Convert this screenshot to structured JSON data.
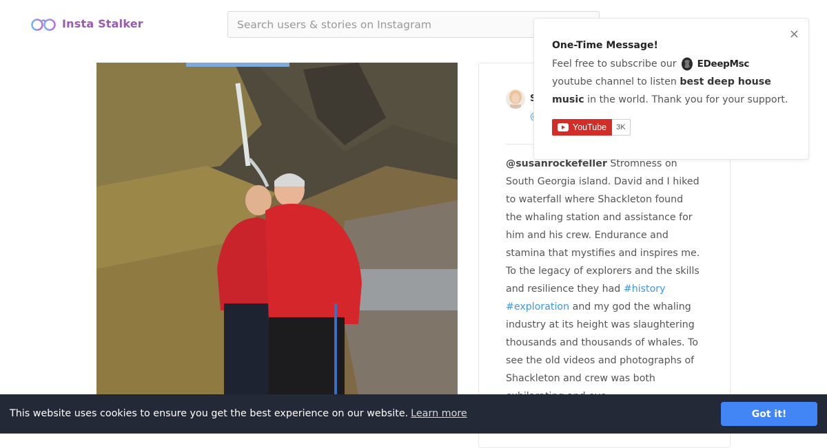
{
  "header": {
    "logo_text": "Insta Stalker",
    "search_placeholder": "Search users & stories on Instagram"
  },
  "post": {
    "user_initial": "S",
    "handle_initial": "@",
    "caption": {
      "mention": "@susanrockefeller",
      "text_1": " Stromness on South Georgia island. David and I hiked to waterfall where Shackleton found the whaling station and assistance for him and his crew. Endurance and stamina that mystifies and inspires me. To the legacy of explorers and the skills and resilience they had ",
      "tag_1": "#history",
      "tag_2": "#exploration",
      "text_2": " and my god the whaling industry at its height was slaughtering thousands and thousands of whales. To see the old videos and photographs of Shackleton and crew was both exhilarating and eye"
    }
  },
  "popup": {
    "title": "One-Time Message!",
    "body_1": "Feel free to subscribe our",
    "brand": "EDeepMsc",
    "body_2": "youtube channel to listen",
    "body_bold": "best deep house music",
    "body_3": "in the world. Thank you for your support.",
    "close_glyph": "×",
    "youtube_label": "YouTube",
    "youtube_count": "3K"
  },
  "cookie": {
    "message": "This website uses cookies to ensure you get the best experience on our website.",
    "learn_more": "Learn more",
    "accept_label": "Got it!"
  },
  "colors": {
    "brand": "#9b59b6",
    "link": "#3897f0",
    "cookie_bg": "#232936",
    "cookie_button": "#4285f4",
    "youtube_red": "#d32d27"
  }
}
